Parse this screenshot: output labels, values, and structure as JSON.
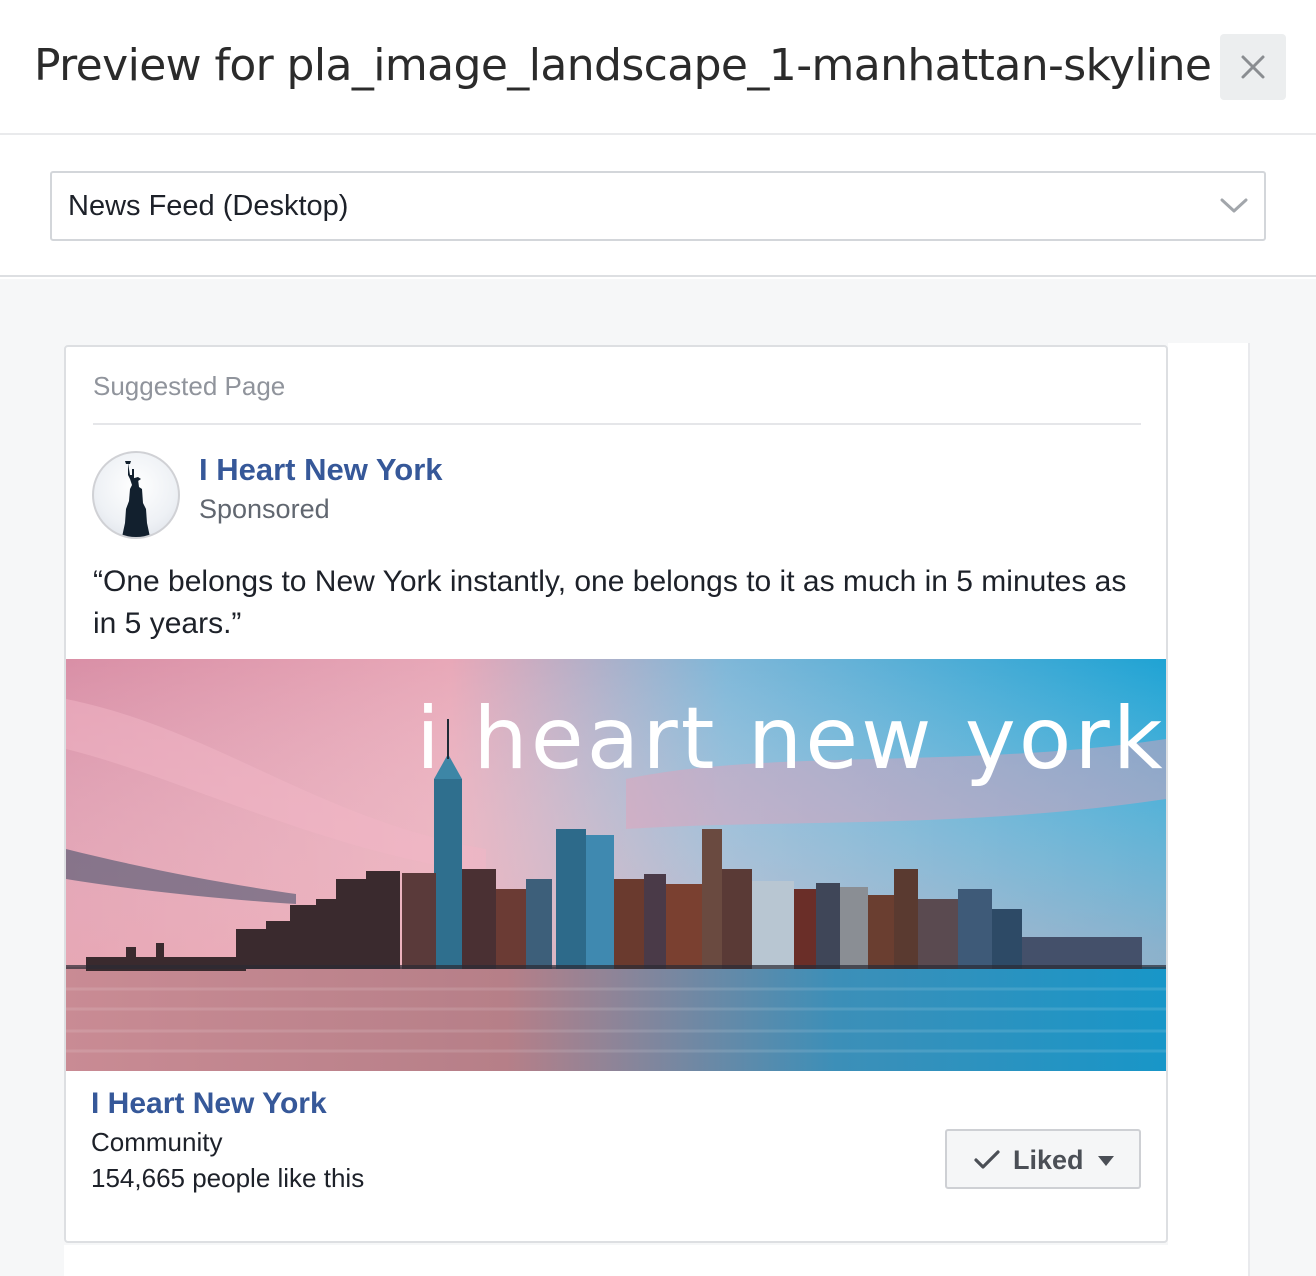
{
  "dialog": {
    "title": "Preview for pla_image_landscape_1-manhattan-skyline",
    "close_icon": "close-icon"
  },
  "placement_select": {
    "selected": "News Feed (Desktop)",
    "chevron_icon": "chevron-down-icon"
  },
  "ad": {
    "label": "Suggested Page",
    "page_name": "I Heart New York",
    "sponsored": "Sponsored",
    "avatar_icon": "statue-of-liberty-icon",
    "text": "“One belongs to New York instantly, one belongs to it as much in 5 minutes as in 5 years.”",
    "image_overlay": "i heart new york",
    "footer": {
      "name": "I Heart New York",
      "category": "Community",
      "likes": "154,665 people like this"
    },
    "liked_button": {
      "label": "Liked",
      "check_icon": "check-icon",
      "caret_icon": "caret-down-icon"
    }
  },
  "colors": {
    "link_blue": "#365899",
    "sky_blue": "#2a9fd0",
    "sky_pink": "#e8a0b4"
  }
}
